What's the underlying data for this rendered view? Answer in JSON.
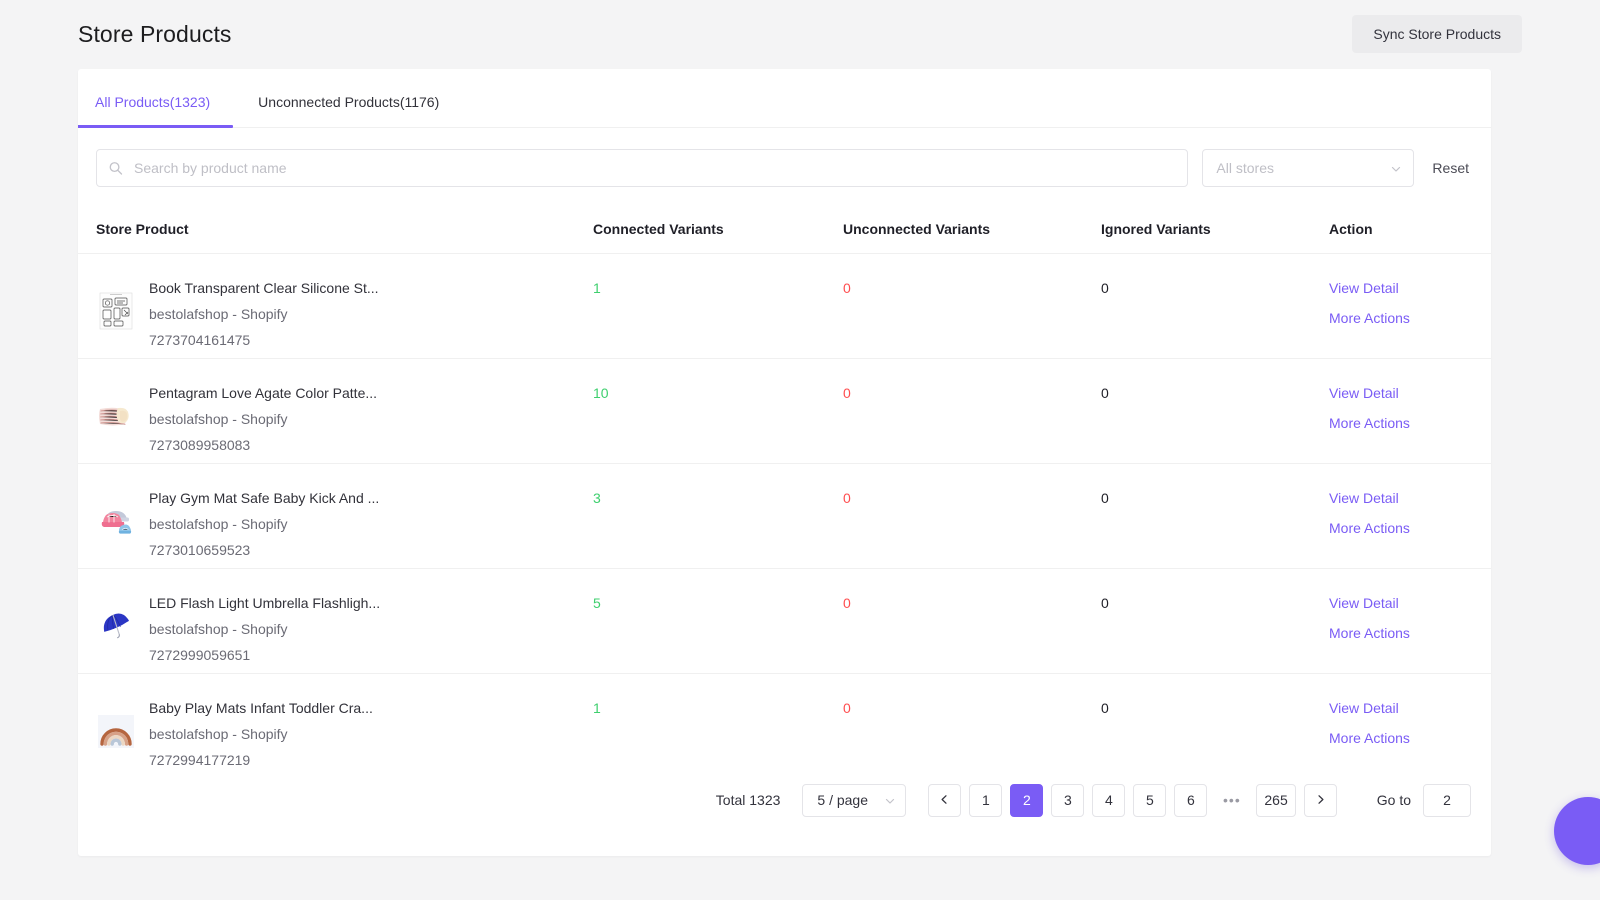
{
  "header": {
    "title": "Store Products",
    "sync_button": "Sync Store Products"
  },
  "tabs": [
    {
      "label": "All Products(1323)",
      "active": true
    },
    {
      "label": "Unconnected Products(1176)",
      "active": false
    }
  ],
  "filters": {
    "search_placeholder": "Search by product name",
    "search_value": "",
    "store_select_value": "All stores",
    "reset_label": "Reset"
  },
  "table": {
    "columns": [
      "Store Product",
      "Connected Variants",
      "Unconnected Variants",
      "Ignored Variants",
      "Action"
    ],
    "rows": [
      {
        "name": "Book Transparent Clear Silicone St...",
        "store": "bestolafshop - Shopify",
        "id": "7273704161475",
        "connected": "1",
        "unconnected": "0",
        "ignored": "0",
        "view_detail": "View Detail",
        "more_actions": "More Actions",
        "thumb": "book-silicone-stamps-thumb"
      },
      {
        "name": "Pentagram Love Agate Color Patte...",
        "store": "bestolafshop - Shopify",
        "id": "7273089958083",
        "connected": "10",
        "unconnected": "0",
        "ignored": "0",
        "view_detail": "View Detail",
        "more_actions": "More Actions",
        "thumb": "agate-coaster-thumb"
      },
      {
        "name": "Play Gym Mat Safe Baby Kick And ...",
        "store": "bestolafshop - Shopify",
        "id": "7273010659523",
        "connected": "3",
        "unconnected": "0",
        "ignored": "0",
        "view_detail": "View Detail",
        "more_actions": "More Actions",
        "thumb": "play-gym-mat-thumb"
      },
      {
        "name": "LED Flash Light Umbrella Flashligh...",
        "store": "bestolafshop - Shopify",
        "id": "7272999059651",
        "connected": "5",
        "unconnected": "0",
        "ignored": "0",
        "view_detail": "View Detail",
        "more_actions": "More Actions",
        "thumb": "blue-umbrella-thumb"
      },
      {
        "name": "Baby Play Mats Infant Toddler Cra...",
        "store": "bestolafshop - Shopify",
        "id": "7272994177219",
        "connected": "1",
        "unconnected": "0",
        "ignored": "0",
        "view_detail": "View Detail",
        "more_actions": "More Actions",
        "thumb": "rainbow-play-mat-thumb"
      }
    ]
  },
  "pagination": {
    "total_label": "Total 1323",
    "page_size": "5 / page",
    "prev_icon": "chevron-left-icon",
    "next_icon": "chevron-right-icon",
    "pages": [
      "1",
      "2",
      "3",
      "4",
      "5",
      "6"
    ],
    "ellipsis": "•••",
    "last_page": "265",
    "current_page": "2",
    "goto_label": "Go to",
    "goto_value": "2"
  },
  "fab": {
    "name": "help-chat-fab"
  },
  "colors": {
    "accent": "#7a5cf5",
    "connected_green": "#3ecf6e",
    "unconnected_red": "#ff4d4f",
    "page_bg": "#f4f4f5",
    "card_bg": "#ffffff"
  }
}
